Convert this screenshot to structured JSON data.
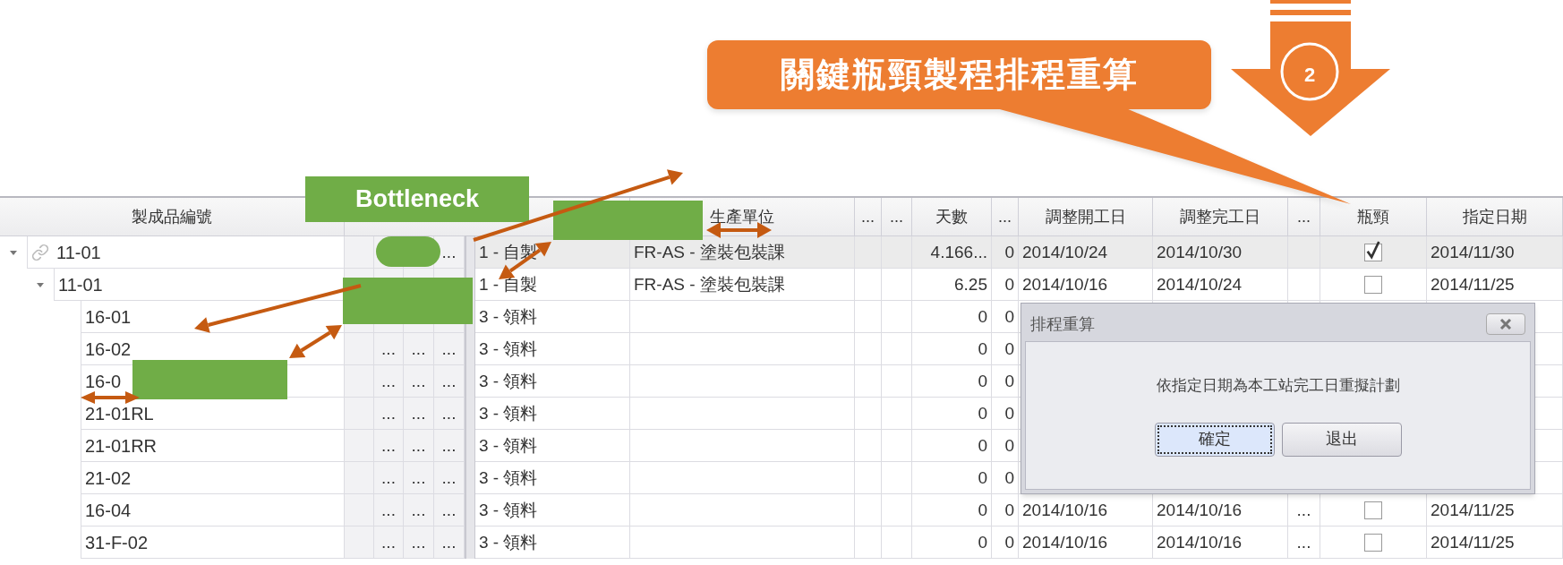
{
  "annotations": {
    "callout": "關鍵瓶頸製程排程重算",
    "step": "2",
    "bottleneck_label": "Bottleneck"
  },
  "table": {
    "columns": [
      {
        "label": "製成品編號"
      },
      {},
      {},
      {},
      {},
      {},
      {
        "label": "生產單位"
      },
      {
        "label": "..."
      },
      {
        "label": "..."
      },
      {
        "label": "天數"
      },
      {
        "label": "..."
      },
      {
        "label": "調整開工日"
      },
      {
        "label": "調整完工日"
      },
      {
        "label": "..."
      },
      {
        "label": "瓶頸"
      },
      {
        "label": "指定日期"
      }
    ],
    "rows": [
      {
        "selected": true,
        "expanded": true,
        "linked": true,
        "cells": [
          "11-01",
          null,
          null,
          null,
          "...",
          "1 - 自製",
          "FR-AS - 塗裝包裝課",
          null,
          null,
          "4.166...",
          "0",
          "2014/10/24",
          "2014/10/30",
          null,
          {
            "checked": true
          },
          "2014/11/30"
        ],
        "children": [
          {
            "selected": false,
            "expanded": true,
            "linked": false,
            "cells": [
              "11-01",
              null,
              null,
              null,
              null,
              "1 - 自製",
              "FR-AS - 塗裝包裝課",
              null,
              null,
              "6.25",
              "0",
              "2014/10/16",
              "2014/10/24",
              null,
              {
                "checked": false
              },
              "2014/11/25"
            ],
            "children": [
              {
                "selected": false,
                "linked": false,
                "cells": [
                  "16-01",
                  null,
                  null,
                  null,
                  null,
                  "3 - 領料",
                  null,
                  null,
                  null,
                  "0",
                  "0",
                  null,
                  null,
                  null,
                  null,
                  null
                ]
              },
              {
                "selected": false,
                "linked": false,
                "cells": [
                  "16-02",
                  null,
                  "...",
                  "...",
                  "...",
                  "3 - 領料",
                  null,
                  null,
                  null,
                  "0",
                  "0",
                  null,
                  null,
                  null,
                  null,
                  null
                ]
              },
              {
                "selected": false,
                "linked": false,
                "cells": [
                  "16-0",
                  null,
                  "...",
                  "...",
                  "...",
                  "3 - 領料",
                  null,
                  null,
                  null,
                  "0",
                  "0",
                  null,
                  null,
                  null,
                  null,
                  null
                ]
              },
              {
                "selected": false,
                "linked": false,
                "cells": [
                  "21-01RL",
                  null,
                  "...",
                  "...",
                  "...",
                  "3 - 領料",
                  null,
                  null,
                  null,
                  "0",
                  "0",
                  null,
                  null,
                  null,
                  null,
                  null
                ]
              },
              {
                "selected": false,
                "linked": false,
                "cells": [
                  "21-01RR",
                  null,
                  "...",
                  "...",
                  "...",
                  "3 - 領料",
                  null,
                  null,
                  null,
                  "0",
                  "0",
                  null,
                  null,
                  null,
                  null,
                  null
                ]
              },
              {
                "selected": false,
                "linked": false,
                "cells": [
                  "21-02",
                  null,
                  "...",
                  "...",
                  "...",
                  "3 - 領料",
                  null,
                  null,
                  null,
                  "0",
                  "0",
                  null,
                  null,
                  null,
                  null,
                  null
                ]
              },
              {
                "selected": false,
                "linked": false,
                "cells": [
                  "16-04",
                  null,
                  "...",
                  "...",
                  "...",
                  "3 - 領料",
                  null,
                  null,
                  null,
                  "0",
                  "0",
                  "2014/10/16",
                  "2014/10/16",
                  "...",
                  {
                    "checked": false
                  },
                  "2014/11/25"
                ]
              },
              {
                "selected": false,
                "linked": false,
                "cells": [
                  "31-F-02",
                  null,
                  "...",
                  "...",
                  "...",
                  "3 - 領料",
                  null,
                  null,
                  null,
                  "0",
                  "0",
                  "2014/10/16",
                  "2014/10/16",
                  "...",
                  {
                    "checked": false
                  },
                  "2014/11/25"
                ]
              }
            ]
          }
        ]
      }
    ]
  },
  "dialog": {
    "title": "排程重算",
    "message": "依指定日期為本工站完工日重擬計劃",
    "buttons": [
      {
        "label": "確定",
        "focused": true
      },
      {
        "label": "退出",
        "focused": false
      }
    ]
  }
}
